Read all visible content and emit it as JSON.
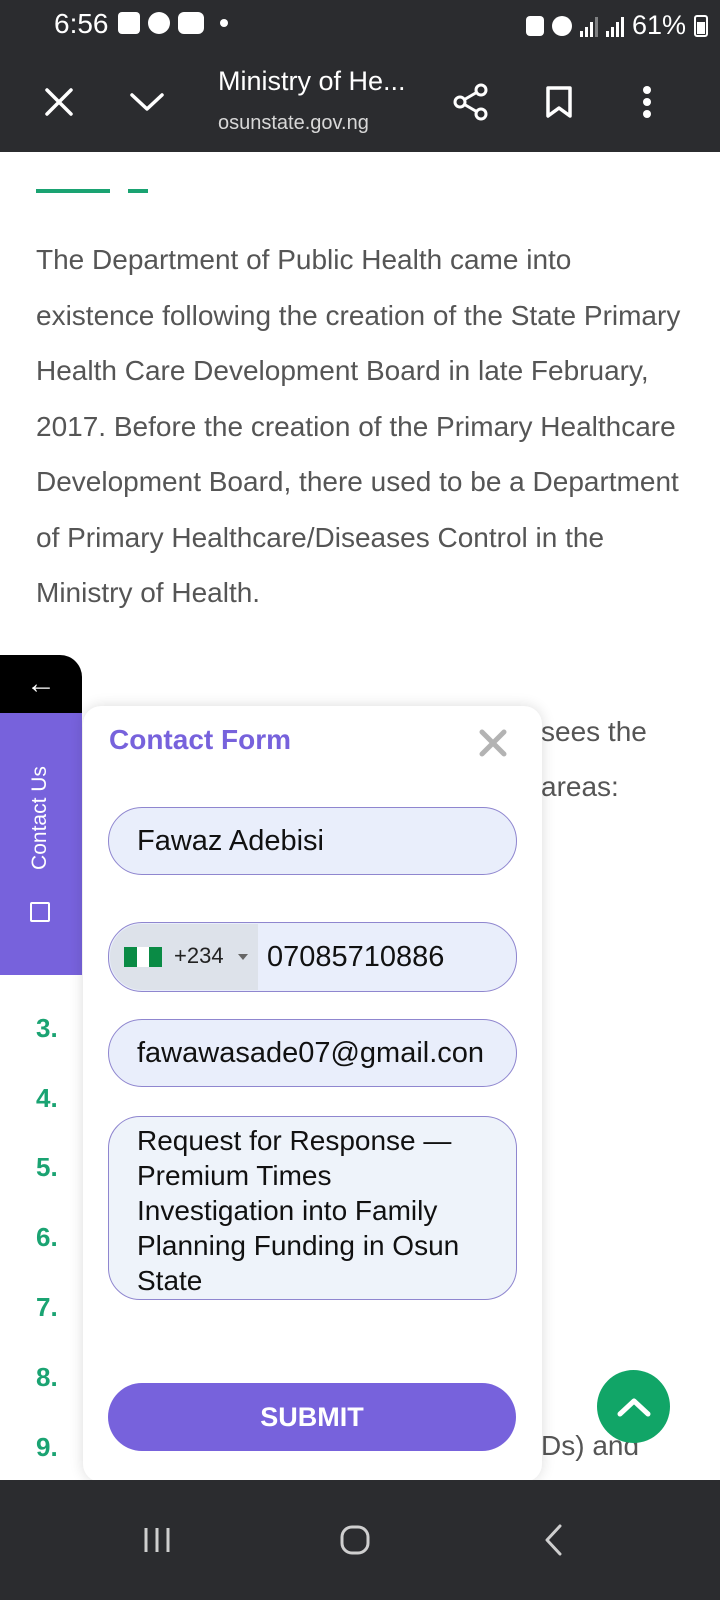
{
  "status_bar": {
    "time": "6:56",
    "battery": "61%"
  },
  "browser": {
    "page_title": "Ministry of He...",
    "url": "osunstate.gov.ng",
    "close_icon": "close-icon",
    "collapse_icon": "chevron-down-icon",
    "share_icon": "share-icon",
    "bookmark_icon": "bookmark-icon",
    "menu_icon": "more-vert-icon"
  },
  "article": {
    "paragraph": "The Department of Public Health came into existence following the creation of the State Primary Health Care Development Board in late February, 2017. Before the creation of the Primary Healthcare Development Board, there used to be a Department of Primary Healthcare/Diseases Control in the Ministry of Health.",
    "partial_line_1": "sees the",
    "partial_line_2": "areas:",
    "partial_line_3": "Ds) and",
    "list_numbers": [
      "3.",
      "4.",
      "5.",
      "6.",
      "7.",
      "8.",
      "9."
    ],
    "accent_color": "#1aa372"
  },
  "side_tab": {
    "arrow": "←",
    "label": "Contact Us"
  },
  "contact_form": {
    "title": "Contact Form",
    "name_value": "Fawaz Adebisi",
    "country_code": "+234",
    "phone_value": "07085710886",
    "email_value": "fawawasade07@gmail.con",
    "message_value": "Request for Response — Premium Times Investigation into Family Planning Funding in Osun State",
    "submit_label": "SUBMIT",
    "accent_color": "#7762dc"
  },
  "scroll_top_icon": "chevron-up-icon",
  "nav_bar": {
    "recents_icon": "recents-icon",
    "home_icon": "home-icon",
    "back_icon": "back-icon"
  }
}
